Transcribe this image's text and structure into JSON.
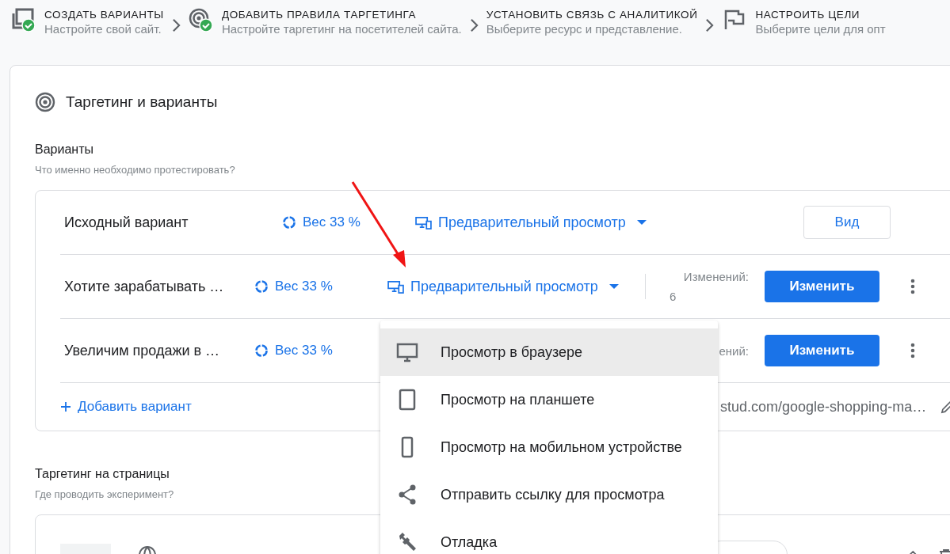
{
  "steps": [
    {
      "kind": "variants",
      "done": true,
      "title": "СОЗДАТЬ ВАРИАНТЫ",
      "subtitle": "Настройте свой сайт."
    },
    {
      "kind": "target",
      "done": true,
      "title": "ДОБАВИТЬ ПРАВИЛА ТАРГЕТИНГА",
      "subtitle": "Настройте таргетинг на посетителей сайта."
    },
    {
      "kind": "analytics",
      "done": false,
      "title": "УСТАНОВИТЬ СВЯЗЬ С АНАЛИТИКОЙ",
      "subtitle": "Выберите ресурс и представление."
    },
    {
      "kind": "goal",
      "done": false,
      "title": "НАСТРОИТЬ ЦЕЛИ",
      "subtitle": "Выберите цели для опт"
    }
  ],
  "section": {
    "title": "Таргетинг и варианты"
  },
  "variants": {
    "title": "Варианты",
    "subtitle": "Что именно необходимо протестировать?",
    "rows": [
      {
        "kind": "original",
        "name": "Исходный вариант",
        "weight": "Вес 33 %",
        "preview": "Предварительный просмотр",
        "action": "Вид"
      },
      {
        "kind": "variant",
        "name": "Хотите зарабатывать …",
        "weight": "Вес 33 %",
        "preview": "Предварительный просмотр",
        "changes_label": "Изменений:",
        "changes_count": "6",
        "action": "Изменить"
      },
      {
        "kind": "variant",
        "name": "Увеличим продажи в …",
        "weight": "Вес 33 %",
        "changes_label": "ений:",
        "action": "Изменить"
      }
    ],
    "add_button": "Добавить вариант",
    "url": "stud.com/google-shopping-ma…"
  },
  "menu": [
    {
      "kind": "desktop",
      "label": "Просмотр в браузере",
      "selected": true
    },
    {
      "kind": "tablet",
      "label": "Просмотр на планшете",
      "selected": false
    },
    {
      "kind": "phone",
      "label": "Просмотр на мобильном устройстве",
      "selected": false
    },
    {
      "kind": "share",
      "label": "Отправить ссылку для просмотра",
      "selected": false
    },
    {
      "kind": "wrench",
      "label": "Отладка",
      "selected": false
    }
  ],
  "pages": {
    "title": "Таргетинг на страницы",
    "subtitle": "Где проводить эксперимент?"
  }
}
